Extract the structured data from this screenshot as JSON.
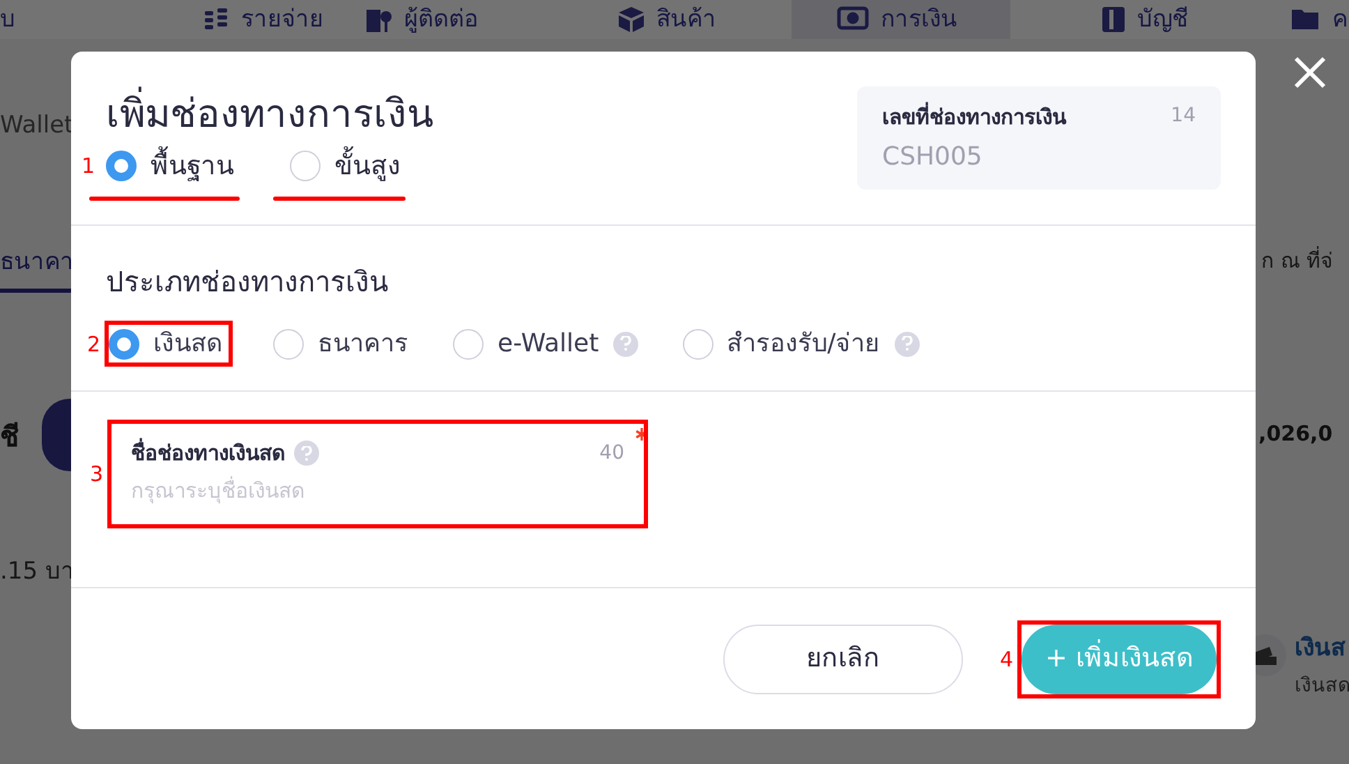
{
  "background": {
    "nav": [
      {
        "label": "บ",
        "selected": false
      },
      {
        "label": "รายจ่าย",
        "selected": false
      },
      {
        "label": "ผู้ติดต่อ",
        "selected": false
      },
      {
        "label": "สินค้า",
        "selected": false
      },
      {
        "label": "การเงิน",
        "selected": true
      },
      {
        "label": "บัญชี",
        "selected": false
      },
      {
        "label": "ค",
        "selected": false
      }
    ],
    "left_texts": [
      "Wallet",
      "ธนาคา",
      "ชี",
      ".15 บา"
    ],
    "right_texts": [
      "ก ณ ที่จ่",
      ",026,0",
      "เงินส",
      "เงินสด"
    ]
  },
  "dialog": {
    "title": "เพิ่มช่องทางการเงิน",
    "modes": [
      {
        "label": "พื้นฐาน",
        "selected": true,
        "underlined": true,
        "marker": "1"
      },
      {
        "label": "ขั้นสูง",
        "selected": false,
        "underlined": true
      }
    ],
    "doc_number": {
      "label": "เลขที่ช่องทางการเงิน",
      "count": "14",
      "value": "CSH005"
    },
    "type_section": {
      "title": "ประเภทช่องทางการเงิน",
      "options": [
        {
          "label": "เงินสด",
          "selected": true,
          "help": false,
          "highlighted": true,
          "marker": "2"
        },
        {
          "label": "ธนาคาร",
          "selected": false,
          "help": false,
          "highlighted": false
        },
        {
          "label": "e-Wallet",
          "selected": false,
          "help": true,
          "highlighted": false
        },
        {
          "label": "สำรองรับ/จ่าย",
          "selected": false,
          "help": true,
          "highlighted": false
        }
      ]
    },
    "name_field": {
      "label": "ชื่อช่องทางเงินสด",
      "help": true,
      "counter": "40",
      "required": true,
      "placeholder": "กรุณาระบุชื่อเงินสด",
      "highlighted": true,
      "marker": "3"
    },
    "buttons": [
      {
        "kind": "secondary",
        "label": "ยกเลิก",
        "highlighted": false
      },
      {
        "kind": "primary",
        "label": "+ เพิ่มเงินสด",
        "highlighted": true,
        "marker": "4"
      }
    ]
  }
}
